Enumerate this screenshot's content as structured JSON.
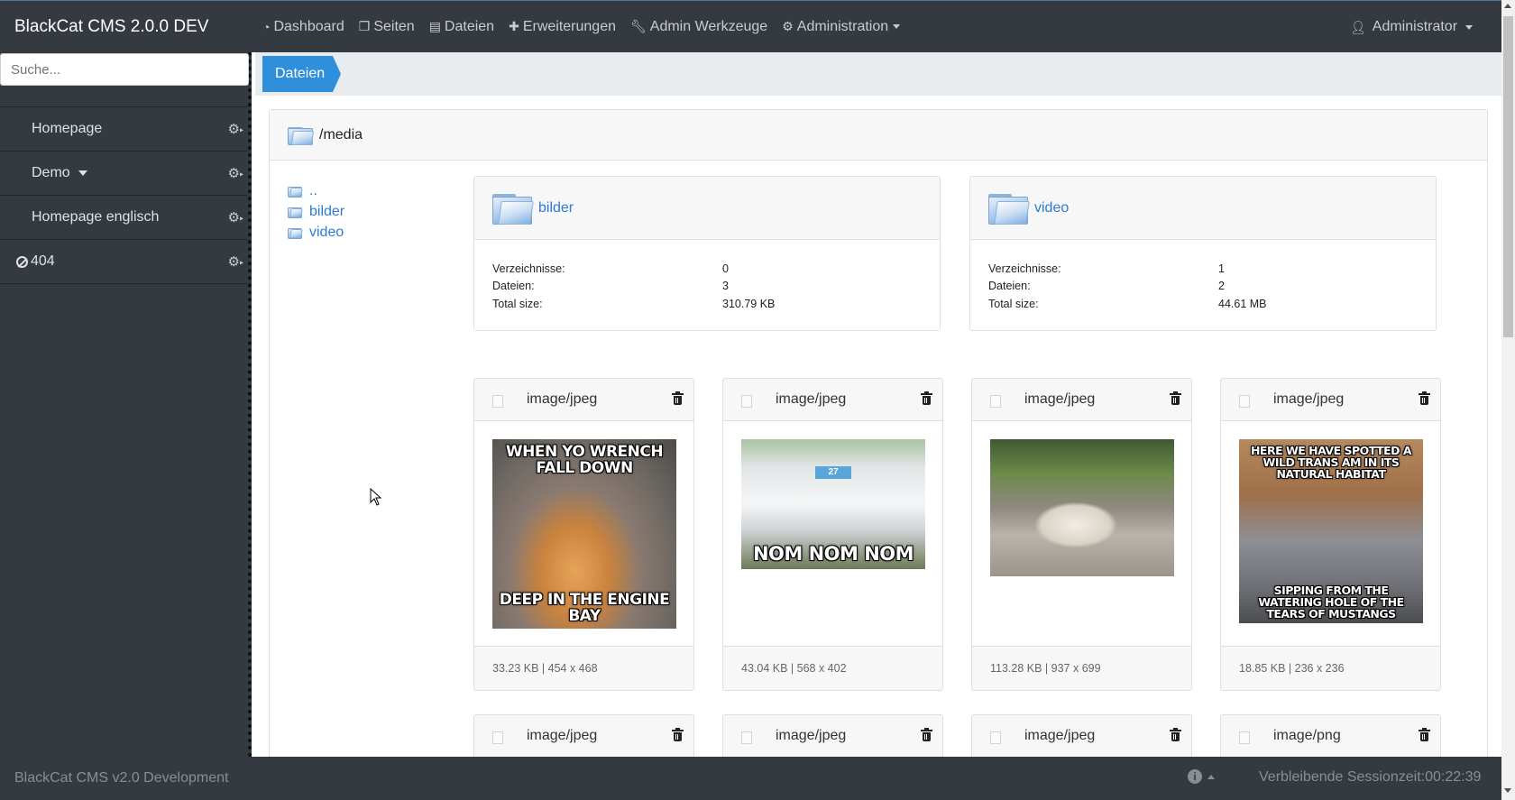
{
  "app": {
    "title": "BlackCat CMS 2.0.0 DEV"
  },
  "nav": {
    "items": [
      {
        "label": "Dashboard",
        "icon": "dashboard-icon"
      },
      {
        "label": "Seiten",
        "icon": "pages-icon"
      },
      {
        "label": "Dateien",
        "icon": "files-icon"
      },
      {
        "label": "Erweiterungen",
        "icon": "puzzle-icon"
      },
      {
        "label": "Admin Werkzeuge",
        "icon": "wrench-icon"
      },
      {
        "label": "Administration",
        "icon": "cogs-icon"
      }
    ],
    "user": "Administrator"
  },
  "sidebar": {
    "search_placeholder": "Suche...",
    "items": [
      {
        "label": "Homepage"
      },
      {
        "label": "Demo"
      },
      {
        "label": "Homepage englisch"
      },
      {
        "label": "404"
      }
    ]
  },
  "breadcrumb": {
    "current": "Dateien"
  },
  "browser": {
    "path": "/media",
    "tree": [
      "..",
      "bilder",
      "video"
    ],
    "stat_labels": {
      "dirs": "Verzeichnisse:",
      "files": "Dateien:",
      "size": "Total size:"
    },
    "folders": [
      {
        "name": "bilder",
        "dirs": "0",
        "files": "3",
        "size": "310.79 KB"
      },
      {
        "name": "video",
        "dirs": "1",
        "files": "2",
        "size": "44.61 MB"
      }
    ],
    "files": [
      {
        "type": "image/jpeg",
        "meta": "33.23 KB | 454 x 468",
        "caption_top": "WHEN YO WRENCH FALL DOWN",
        "caption_bottom": "DEEP IN THE ENGINE BAY"
      },
      {
        "type": "image/jpeg",
        "meta": "43.04 KB | 568 x 402",
        "caption_bottom": "NOM NOM NOM",
        "plate": "27"
      },
      {
        "type": "image/jpeg",
        "meta": "113.28 KB | 937 x 699"
      },
      {
        "type": "image/jpeg",
        "meta": "18.85 KB | 236 x 236",
        "caption_top": "HERE WE HAVE SPOTTED A WILD TRANS AM IN ITS NATURAL HABITAT",
        "caption_bottom": "SIPPING FROM THE WATERING HOLE OF THE TEARS OF MUSTANGS"
      },
      {
        "type": "image/jpeg"
      },
      {
        "type": "image/jpeg"
      },
      {
        "type": "image/jpeg"
      },
      {
        "type": "image/png"
      }
    ]
  },
  "footer": {
    "text": "BlackCat CMS v2.0 Development",
    "session": "Verbleibende Sessionzeit:00:22:39"
  }
}
